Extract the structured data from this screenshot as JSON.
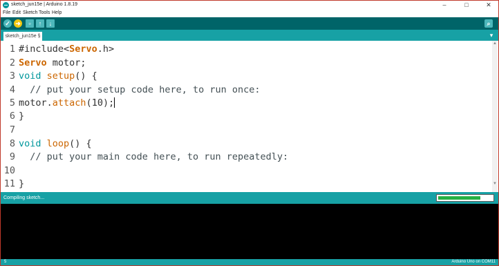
{
  "window": {
    "title": "sketch_jun15e | Arduino 1.8.19",
    "minimize": "–",
    "maximize": "□",
    "close": "✕"
  },
  "menu": [
    "File",
    "Edit",
    "Sketch",
    "Tools",
    "Help"
  ],
  "toolbar": {
    "verify_glyph": "✓",
    "upload_glyph": "➜",
    "new_glyph": "▫",
    "open_glyph": "↑",
    "save_glyph": "↓",
    "serial_glyph": "⌕",
    "icons": [
      "check-icon",
      "arrow-right-icon",
      "new-file-icon",
      "open-arrow-icon",
      "save-arrow-icon",
      "magnifier-icon"
    ]
  },
  "tab": {
    "label": "sketch_jun15e §",
    "menu_glyph": "▾"
  },
  "editor": {
    "line_numbers": [
      "1",
      "2",
      "3",
      "4",
      "5",
      "6",
      "7",
      "8",
      "9",
      "10",
      "11"
    ],
    "code": {
      "l1_directive": "#include<",
      "l1_type": "Servo",
      "l1_rest": ".h>",
      "l2_type": "Servo",
      "l2_rest": " motor;",
      "l3_kw": "void",
      "l3_fn": "setup",
      "l3_rest": "() {",
      "l4_comment": "  // put your setup code here, to run once:",
      "l5_obj": "motor.",
      "l5_fn": "attach",
      "l5_rest": "(10);",
      "l6": "}",
      "l8_kw": "void",
      "l8_fn": "loop",
      "l8_rest": "() {",
      "l9_comment": "  // put your main code here, to run repeatedly:",
      "l11": "}"
    }
  },
  "status": {
    "message": "Compiling sketch...",
    "progress_fraction": 0.78
  },
  "bottom": {
    "line_number": "5",
    "board": "Arduino Uno on COM11"
  },
  "colors": {
    "toolbar": "#006468",
    "tabstrip": "#17a1a5",
    "keyword_type": "#cc6600",
    "keyword_void": "#00979c",
    "progress": "#26b043",
    "upload_button": "#f3c70f"
  }
}
